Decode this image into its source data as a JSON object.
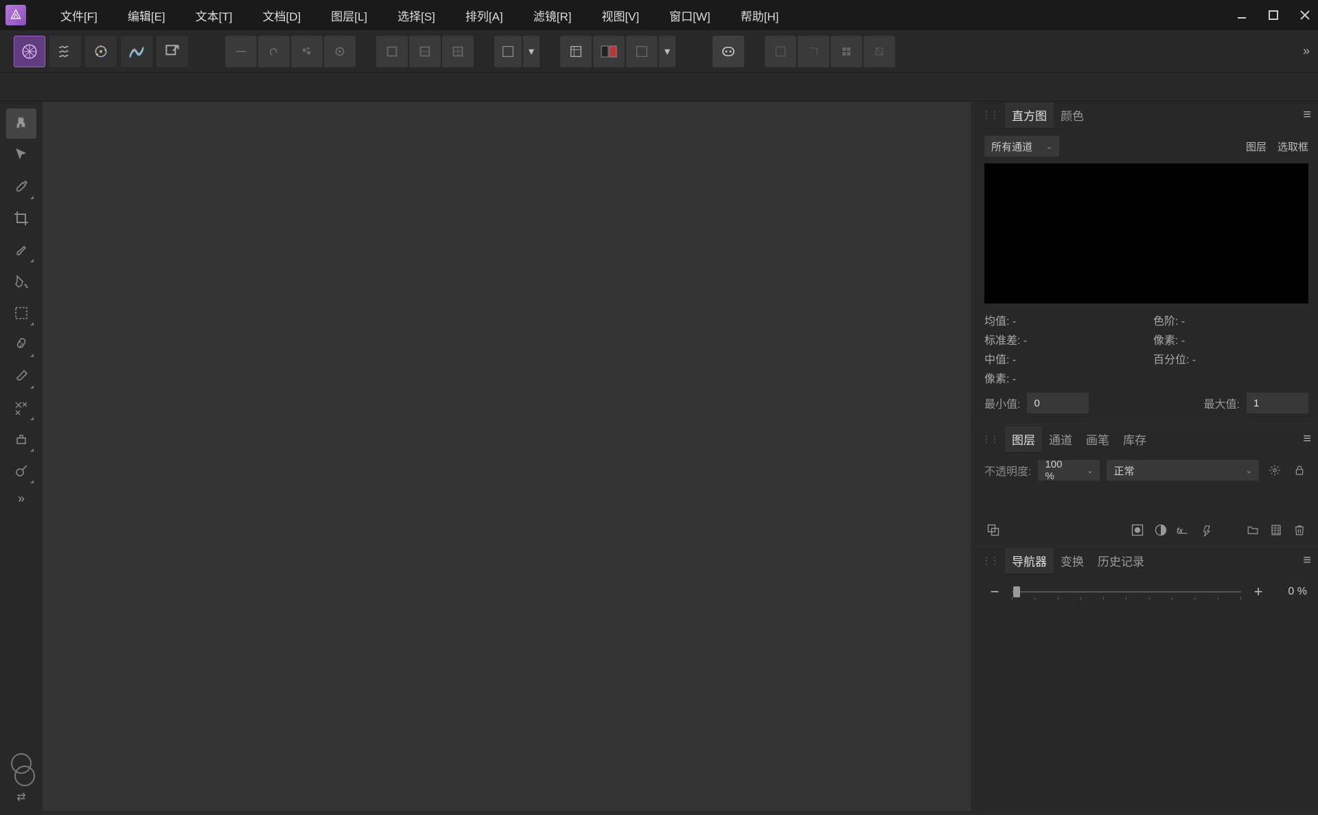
{
  "menu": {
    "file": "文件[F]",
    "edit": "编辑[E]",
    "text": "文本[T]",
    "document": "文档[D]",
    "layer": "图层[L]",
    "select": "选择[S]",
    "arrange": "排列[A]",
    "filter": "滤镜[R]",
    "view": "视图[V]",
    "window": "窗口[W]",
    "help": "帮助[H]"
  },
  "panels": {
    "hist": {
      "tab_hist": "直方图",
      "tab_color": "颜色",
      "channel": "所有通道",
      "btn_layer": "图层",
      "btn_marquee": "选取框",
      "mean": "均值: -",
      "stdev": "标准差: -",
      "median": "中值: -",
      "pixels": "像素: -",
      "levels": "色阶: -",
      "px": "像素: -",
      "pct": "百分位: -",
      "min_l": "最小值:",
      "min_v": "0",
      "max_l": "最大值:",
      "max_v": "1"
    },
    "layers": {
      "tab_layers": "图层",
      "tab_channels": "通道",
      "tab_brushes": "画笔",
      "tab_stock": "库存",
      "opacity_l": "不透明度:",
      "opacity_v": "100 %",
      "blend": "正常"
    },
    "nav": {
      "tab_nav": "导航器",
      "tab_xform": "变换",
      "tab_history": "历史记录",
      "zoom": "0 %"
    }
  }
}
